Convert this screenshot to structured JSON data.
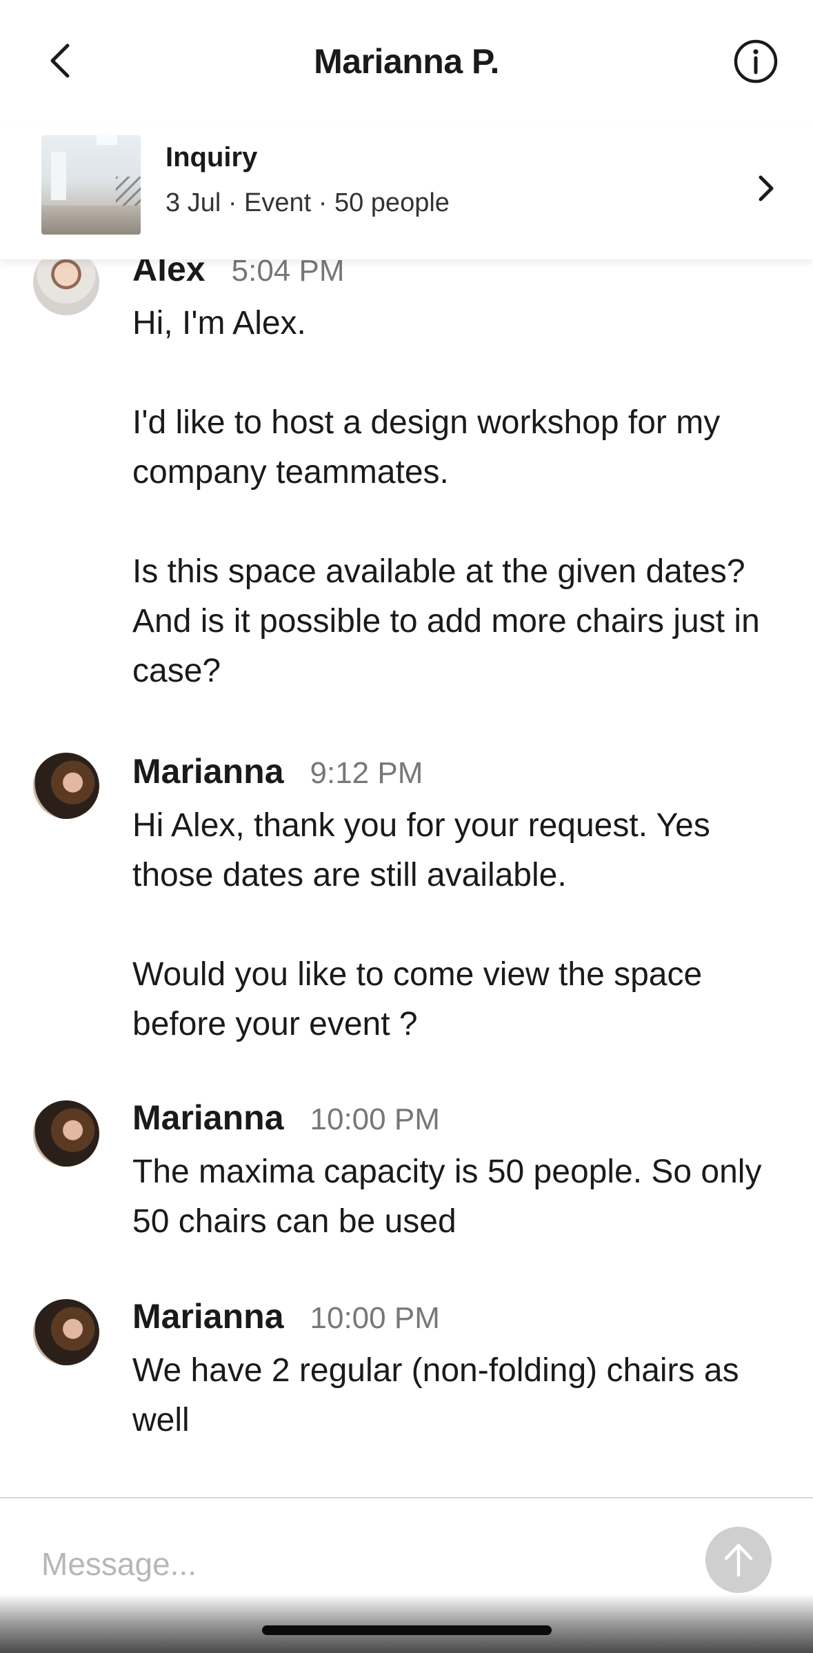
{
  "header": {
    "title": "Marianna P.",
    "back_icon": "chevron-left-icon",
    "info_icon": "info-circle-icon"
  },
  "inquiry": {
    "title": "Inquiry",
    "meta": "3 Jul · Event · 50 people",
    "chevron_icon": "chevron-right-icon"
  },
  "messages": [
    {
      "sender": "Alex",
      "time": "5:04 PM",
      "text": "Hi, I'm Alex.\n\nI'd like to host a design workshop for my company teammates.\n\nIs this space available at the given dates? And is it possible to add more chairs just in case?"
    },
    {
      "sender": "Marianna",
      "time": "9:12 PM",
      "text": "Hi Alex, thank you for your request. Yes those dates are still available.\n\nWould you like to come view the space before your event ?"
    },
    {
      "sender": "Marianna",
      "time": "10:00 PM",
      "text": "The maxima capacity is 50 people. So only 50 chairs can be used"
    },
    {
      "sender": "Marianna",
      "time": "10:00 PM",
      "text": "We have 2 regular (non-folding) chairs as well"
    }
  ],
  "composer": {
    "placeholder": "Message...",
    "value": "",
    "send_icon": "arrow-up-icon"
  },
  "colors": {
    "send_button_disabled": "#cfcfcf",
    "timestamp": "#777777"
  }
}
